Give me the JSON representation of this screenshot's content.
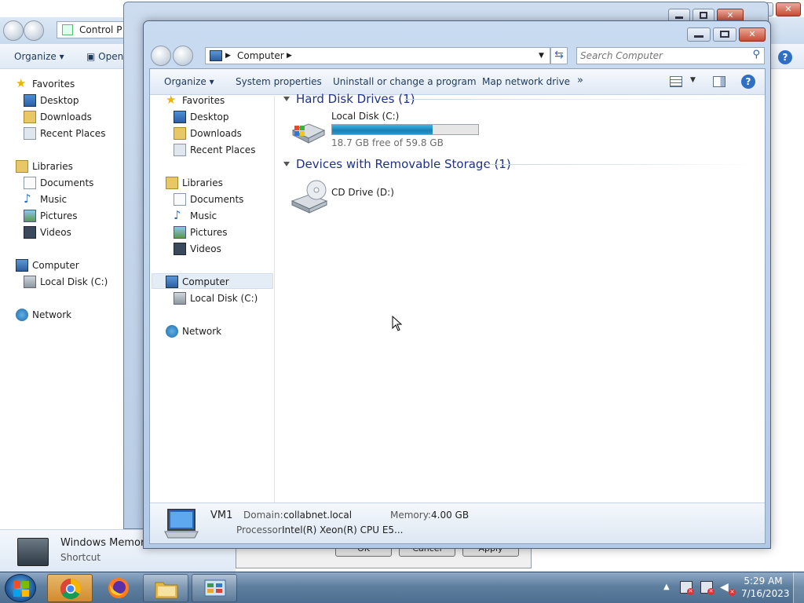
{
  "background_window": {
    "address_text": "Control P",
    "cmd": {
      "organize": "Organize",
      "open": "Open"
    },
    "nav": {
      "favorites": "Favorites",
      "desktop": "Desktop",
      "downloads": "Downloads",
      "recent_places": "Recent Places",
      "libraries": "Libraries",
      "documents": "Documents",
      "music": "Music",
      "pictures": "Pictures",
      "videos": "Videos",
      "computer": "Computer",
      "local_disk": "Local Disk (C:)",
      "network": "Network"
    },
    "details": {
      "title": "Windows Memory",
      "subtitle": "Shortcut"
    }
  },
  "behind_dialog": {
    "ok": "OK",
    "cancel": "Cancel",
    "apply": "Apply"
  },
  "main_window": {
    "breadcrumb": "Computer",
    "search_placeholder": "Search Computer",
    "toolbar": {
      "organize": "Organize",
      "system_properties": "System properties",
      "uninstall": "Uninstall or change a program",
      "map_drive": "Map network drive",
      "more": "»"
    },
    "nav": {
      "favorites": "Favorites",
      "desktop": "Desktop",
      "downloads": "Downloads",
      "recent_places": "Recent Places",
      "libraries": "Libraries",
      "documents": "Documents",
      "music": "Music",
      "pictures": "Pictures",
      "videos": "Videos",
      "computer": "Computer",
      "local_disk": "Local Disk (C:)",
      "network": "Network"
    },
    "groups": {
      "hard_disk": "Hard Disk Drives (1)",
      "removable": "Devices with Removable Storage (1)"
    },
    "drives": {
      "local_disk": {
        "name": "Local Disk (C:)",
        "free": "18.7 GB free of 59.8 GB",
        "used_fraction": 0.687
      },
      "cd_drive": {
        "name": "CD Drive (D:)"
      }
    },
    "details": {
      "computer_name": "VM1",
      "domain_label": "Domain:",
      "domain_value": "collabnet.local",
      "memory_label": "Memory:",
      "memory_value": "4.00 GB",
      "processor_label": "Processor:",
      "processor_value": "Intel(R) Xeon(R) CPU E5..."
    }
  },
  "taskbar": {
    "time": "5:29 AM",
    "date": "7/16/2023"
  },
  "colors": {
    "accent": "#1e3287",
    "progress": "#1b7fb8",
    "taskbar": "#5f7f9f"
  }
}
